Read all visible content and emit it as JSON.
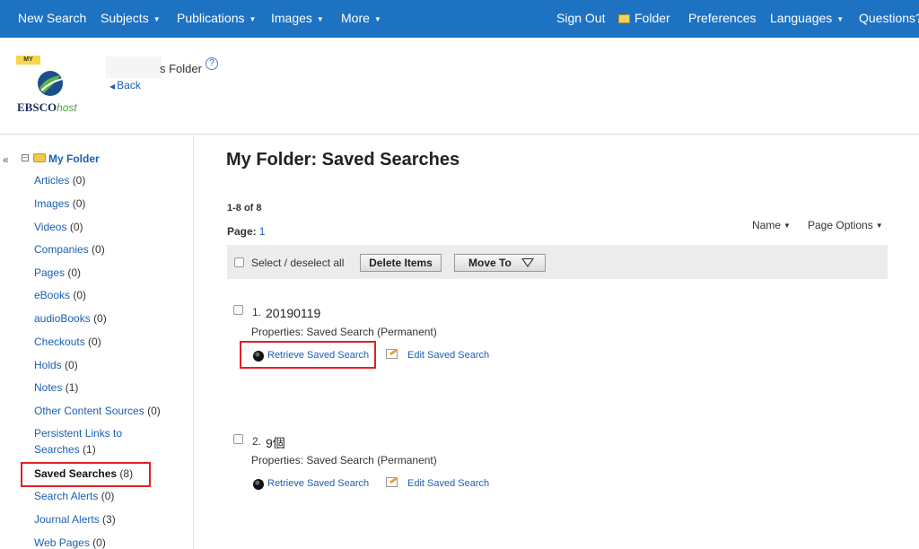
{
  "topnav": {
    "new_search": "New Search",
    "subjects": "Subjects",
    "publications": "Publications",
    "images": "Images",
    "more": "More",
    "sign_out": "Sign Out",
    "folder": "Folder",
    "preferences": "Preferences",
    "languages": "Languages",
    "questions": "Questions?"
  },
  "header": {
    "logo_my": "MY",
    "logo_brand": "EBSCO",
    "logo_host": "host",
    "folder_title": "s Folder",
    "help": "?",
    "back": "Back"
  },
  "sidebar": {
    "collapse": "«",
    "toggle": "⊟",
    "root_label": "My Folder",
    "items": [
      {
        "label": "Articles",
        "count": "(0)"
      },
      {
        "label": "Images",
        "count": "(0)"
      },
      {
        "label": "Videos",
        "count": "(0)"
      },
      {
        "label": "Companies",
        "count": "(0)"
      },
      {
        "label": "Pages",
        "count": "(0)"
      },
      {
        "label": "eBooks",
        "count": "(0)"
      },
      {
        "label": "audioBooks",
        "count": "(0)"
      },
      {
        "label": "Checkouts",
        "count": "(0)"
      },
      {
        "label": "Holds",
        "count": "(0)"
      },
      {
        "label": "Notes",
        "count": "(1)"
      },
      {
        "label": "Other Content Sources",
        "count": "(0)"
      },
      {
        "label": "Persistent Links to Searches",
        "count": "(1)"
      },
      {
        "label": "Saved Searches",
        "count": "(8)"
      },
      {
        "label": "Search Alerts",
        "count": "(0)"
      },
      {
        "label": "Journal Alerts",
        "count": "(3)"
      },
      {
        "label": "Web Pages",
        "count": "(0)"
      }
    ]
  },
  "main": {
    "title": "My Folder: Saved Searches",
    "count": "1-8 of 8",
    "page_label": "Page:",
    "page_number": "1",
    "sort_name": "Name",
    "page_options": "Page Options",
    "select_all": "Select / deselect all",
    "delete_items": "Delete Items",
    "move_to": "Move To",
    "results": [
      {
        "num": "1.",
        "title": "20190119",
        "properties": "Properties: Saved Search (Permanent)",
        "retrieve": "Retrieve Saved Search",
        "edit": "Edit Saved Search"
      },
      {
        "num": "2.",
        "title": "9個",
        "properties": "Properties: Saved Search (Permanent)",
        "retrieve": "Retrieve Saved Search",
        "edit": "Edit Saved Search"
      }
    ]
  },
  "colors": {
    "nav_bg": "#1d72c2",
    "link": "#1a5fb4",
    "highlight": "#e01f26"
  }
}
